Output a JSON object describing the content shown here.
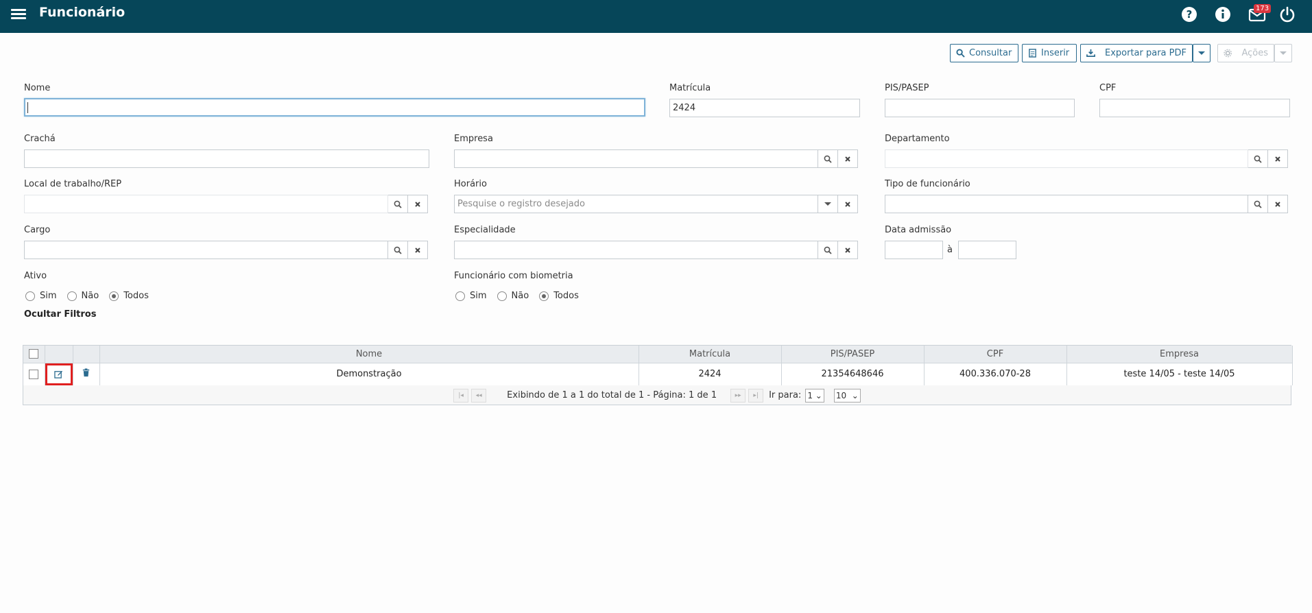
{
  "header": {
    "title": "Funcionário",
    "notifications_count": "173"
  },
  "toolbar": {
    "consultar": "Consultar",
    "inserir": "Inserir",
    "exportar": "Exportar para PDF",
    "acoes": "Ações"
  },
  "filters": {
    "nome": {
      "label": "Nome",
      "value": ""
    },
    "matricula": {
      "label": "Matrícula",
      "value": "2424"
    },
    "pis": {
      "label": "PIS/PASEP",
      "value": ""
    },
    "cpf": {
      "label": "CPF",
      "value": ""
    },
    "cracha": {
      "label": "Crachá",
      "value": ""
    },
    "empresa": {
      "label": "Empresa",
      "value": ""
    },
    "departamento": {
      "label": "Departamento",
      "value": ""
    },
    "local": {
      "label": "Local de trabalho/REP",
      "value": ""
    },
    "horario": {
      "label": "Horário",
      "placeholder": "Pesquise o registro desejado"
    },
    "tipo": {
      "label": "Tipo de funcionário",
      "value": ""
    },
    "cargo": {
      "label": "Cargo",
      "value": ""
    },
    "especialidade": {
      "label": "Especialidade",
      "value": ""
    },
    "data_admissao": {
      "label": "Data admissão",
      "sep": "à"
    },
    "ativo": {
      "label": "Ativo",
      "options": [
        "Sim",
        "Não",
        "Todos"
      ],
      "selected": "Todos"
    },
    "biometria": {
      "label": "Funcionário com biometria",
      "options": [
        "Sim",
        "Não",
        "Todos"
      ],
      "selected": "Todos"
    },
    "hide_label": "Ocultar Filtros"
  },
  "grid": {
    "columns": [
      "Nome",
      "Matrícula",
      "PIS/PASEP",
      "CPF",
      "Empresa"
    ],
    "rows": [
      {
        "nome": "Demonstração",
        "matricula": "2424",
        "pis": "21354648646",
        "cpf": "400.336.070-28",
        "empresa": "teste 14/05 - teste 14/05"
      }
    ],
    "pager": {
      "info": "Exibindo de 1 a 1 do total de 1 - Página: 1 de 1",
      "goto_label": "Ir para:",
      "page": "1",
      "page_size": "10"
    }
  },
  "colors": {
    "header_bg": "#064659",
    "accent": "#2b6b8f",
    "highlight": "#e02020"
  }
}
